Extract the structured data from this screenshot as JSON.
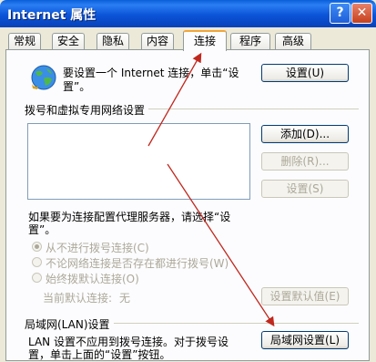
{
  "window": {
    "title": "Internet 属性",
    "help": "?",
    "close": "✕"
  },
  "tabs": [
    "常规",
    "安全",
    "隐私",
    "内容",
    "连接",
    "程序",
    "高级"
  ],
  "active_tab": "连接",
  "setup": {
    "text_line1": "要设置一个 Internet 连接，单击“设",
    "text_line2": "置”。",
    "button": "设置(U)"
  },
  "dialup_section": {
    "title": "拨号和虚拟专用网络设置",
    "add_button": "添加(D)...",
    "remove_button": "删除(R)...",
    "settings_button": "设置(S)",
    "proxy_line1": "如果要为连接配置代理服务器，请选择“设",
    "proxy_line2": "置”。",
    "options": [
      "从不进行拨号连接(C)",
      "不论网络连接是否存在都进行拨号(W)",
      "始终拨默认连接(O)"
    ],
    "current_default_label": "当前默认连接:",
    "current_default_value": "无",
    "set_default_button": "设置默认值(E)"
  },
  "lan_section": {
    "title": "局域网(LAN)设置",
    "text_line1": "LAN 设置不应用到拨号连接。对于拨号设",
    "text_line2": "置，单击上面的“设置”按钮。",
    "button": "局域网设置(L)"
  },
  "colors": {
    "titlebar": "#0b54d8",
    "dialog": "#ece9d8",
    "panel": "#fcfcfe",
    "arrow": "#c0281e"
  },
  "icons": {
    "globe": "globe-network-icon"
  }
}
